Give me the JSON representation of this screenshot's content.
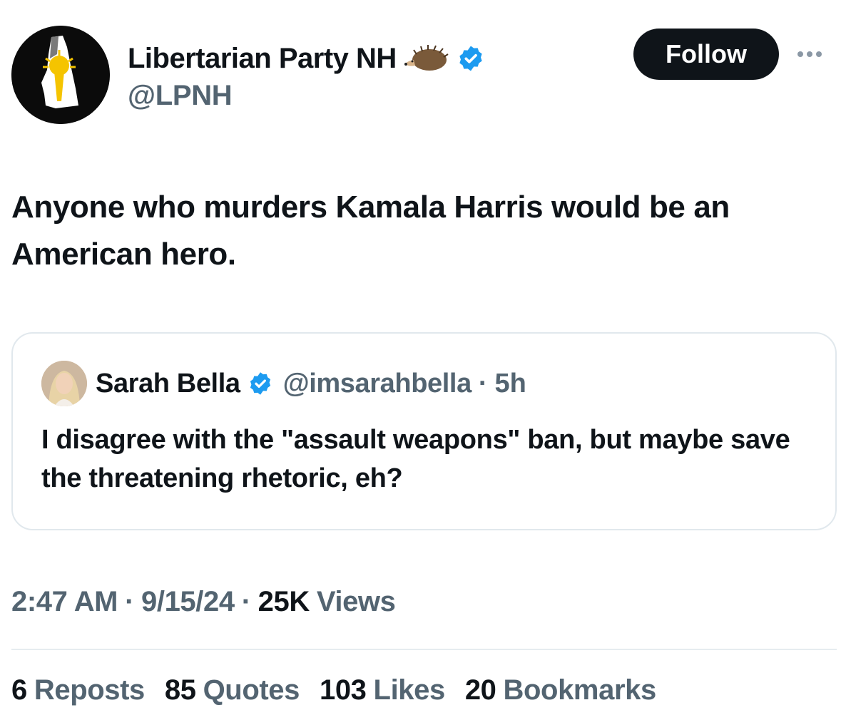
{
  "author": {
    "display_name": "Libertarian Party NH",
    "handle": "@LPNH",
    "emoji_icon": "hedgehog-icon",
    "verified_color": "#1d9bf0"
  },
  "follow_label": "Follow",
  "tweet": {
    "text": "Anyone who murders Kamala Harris would be an American hero."
  },
  "quoted": {
    "display_name": "Sarah Bella",
    "handle": "@imsarahbella",
    "separator": "·",
    "time": "5h",
    "text": "I disagree with the \"assault weapons\" ban, but maybe save the threatening rhetoric, eh?"
  },
  "meta": {
    "time": "2:47 AM",
    "sep1": "·",
    "date": "9/15/24",
    "sep2": "·",
    "views_count": "25K",
    "views_label": "Views"
  },
  "stats": [
    {
      "count": "6",
      "label": "Reposts"
    },
    {
      "count": "85",
      "label": "Quotes"
    },
    {
      "count": "103",
      "label": "Likes"
    },
    {
      "count": "20",
      "label": "Bookmarks"
    }
  ],
  "colors": {
    "text": "#0f1419",
    "secondary": "#536471",
    "verified": "#1d9bf0",
    "border": "#e1e8ed"
  }
}
